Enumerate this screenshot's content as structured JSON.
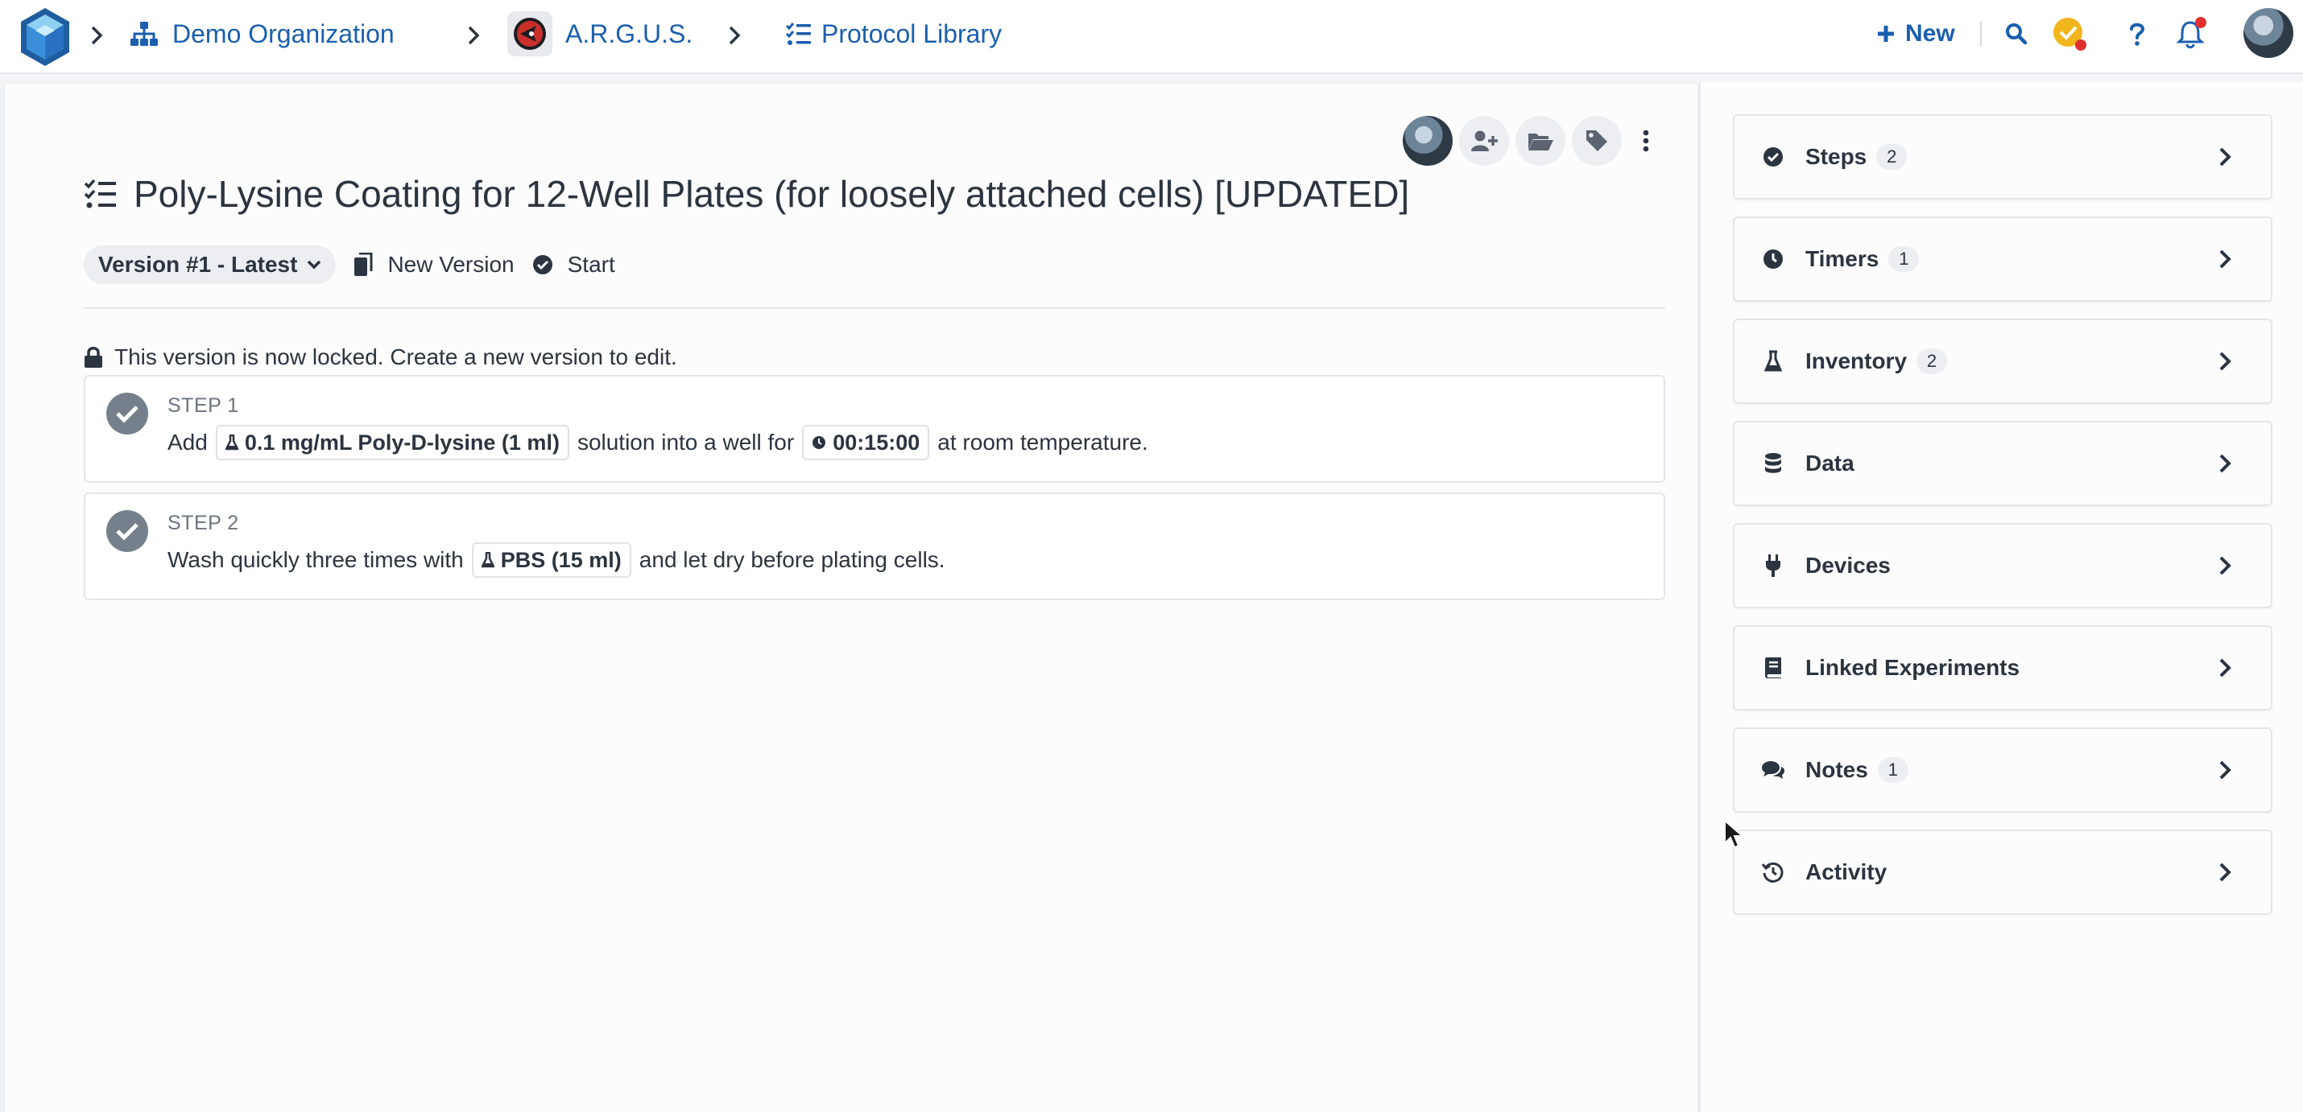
{
  "breadcrumb": {
    "organization": "Demo Organization",
    "project": "A.R.G.U.S.",
    "library": "Protocol Library"
  },
  "topbar": {
    "new_label": "New"
  },
  "protocol": {
    "title": "Poly-Lysine Coating for 12-Well Plates (for loosely attached cells) [UPDATED]",
    "version_label": "Version #1 - Latest",
    "new_version_label": "New Version",
    "start_label": "Start",
    "lock_message": "This version is now locked. Create a new version to edit."
  },
  "steps": [
    {
      "label": "STEP 1",
      "text_before": "Add",
      "inventory_chip": "0.1 mg/mL Poly-D-lysine (1 ml)",
      "text_middle": "solution into a well for",
      "timer_chip": "00:15:00",
      "text_after": "at room temperature."
    },
    {
      "label": "STEP 2",
      "text_before": "Wash quickly three times with",
      "inventory_chip": "PBS (15 ml)",
      "text_after": "and let dry before plating cells."
    }
  ],
  "sidebar": {
    "panels": [
      {
        "label": "Steps",
        "count": "2",
        "icon": "check-circle-icon"
      },
      {
        "label": "Timers",
        "count": "1",
        "icon": "clock-icon"
      },
      {
        "label": "Inventory",
        "count": "2",
        "icon": "flask-icon"
      },
      {
        "label": "Data",
        "count": "",
        "icon": "database-icon"
      },
      {
        "label": "Devices",
        "count": "",
        "icon": "plug-icon"
      },
      {
        "label": "Linked Experiments",
        "count": "",
        "icon": "book-icon"
      },
      {
        "label": "Notes",
        "count": "1",
        "icon": "comments-icon"
      },
      {
        "label": "Activity",
        "count": "",
        "icon": "history-icon"
      }
    ]
  },
  "colors": {
    "link_blue": "#1b5fae",
    "notification_red": "#e0312f",
    "status_yellow": "#f2b51d"
  }
}
